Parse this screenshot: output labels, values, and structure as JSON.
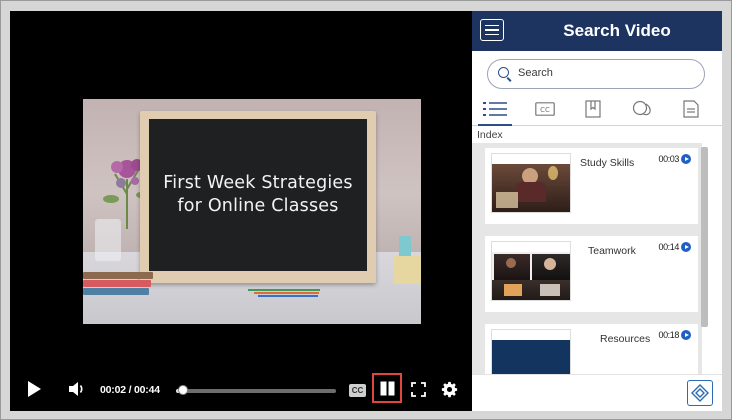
{
  "player": {
    "slide_line1": "First Week Strategies",
    "slide_line2": "for Online Classes",
    "time": "00:02 / 00:44",
    "progress": 0.045,
    "cc_label": "CC",
    "icons": [
      "play-icon",
      "volume-icon",
      "cc-icon",
      "sidebar-toggle-icon",
      "fullscreen-icon",
      "gear-icon"
    ]
  },
  "sidebar": {
    "title": "Search Video",
    "search_placeholder": "Search",
    "tabs": [
      "index-list-icon",
      "captions-icon",
      "bookmark-icon",
      "comments-icon",
      "document-icon"
    ],
    "index_label": "Index",
    "items": [
      {
        "title": "Study Skills",
        "time": "00:03"
      },
      {
        "title": "Teamwork",
        "time": "00:14"
      },
      {
        "title": "Resources",
        "time": "00:18"
      }
    ],
    "accent": "#1d3461"
  }
}
